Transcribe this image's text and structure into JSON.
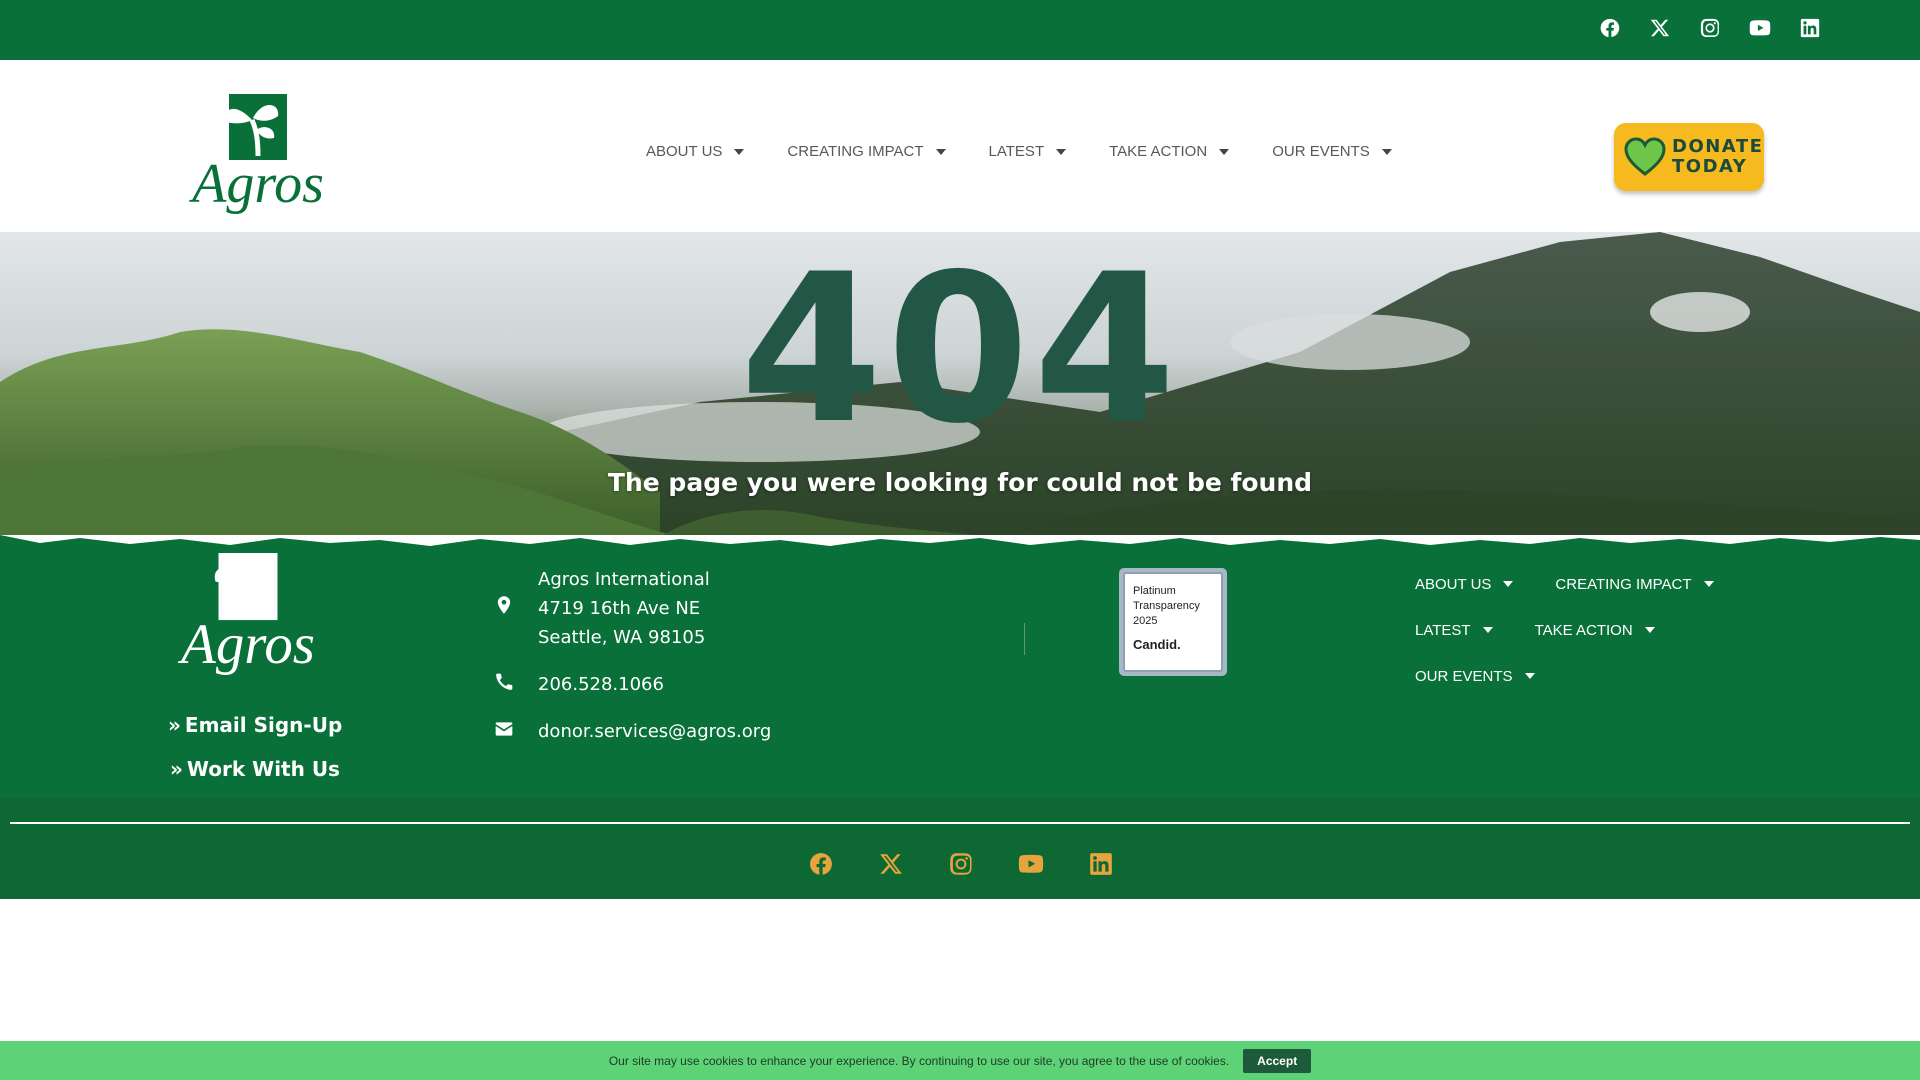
{
  "colors": {
    "brand_green": "#087038",
    "dark_green": "#225745",
    "donate_yellow": "#f6b91e",
    "social_orange": "#e7a33e",
    "cookie_green": "#5dd276"
  },
  "top_social": [
    {
      "icon": "facebook-icon"
    },
    {
      "icon": "x-twitter-icon"
    },
    {
      "icon": "instagram-icon"
    },
    {
      "icon": "youtube-icon"
    },
    {
      "icon": "linkedin-icon"
    }
  ],
  "header": {
    "logo_text": "Agros",
    "nav": [
      {
        "label": "ABOUT US"
      },
      {
        "label": "CREATING IMPACT"
      },
      {
        "label": "LATEST"
      },
      {
        "label": "TAKE ACTION"
      },
      {
        "label": "OUR EVENTS"
      }
    ],
    "donate": {
      "line1": "DONATE",
      "line2": "TODAY"
    }
  },
  "hero": {
    "code": "404",
    "message": "The page you were looking for could not be found"
  },
  "footer": {
    "logo_text": "Agros",
    "links": [
      {
        "label": "Email Sign-Up"
      },
      {
        "label": "Work With Us"
      }
    ],
    "contact": {
      "org": "Agros International",
      "street": "4719 16th Ave NE",
      "city": "Seattle, WA 98105",
      "phone": "206.528.1066",
      "email": "donor.services@agros.org"
    },
    "badge": {
      "line1": "Platinum",
      "line2": "Transparency",
      "line3": "2025",
      "brand": "Candid."
    },
    "nav": [
      {
        "label": "ABOUT US"
      },
      {
        "label": "CREATING IMPACT"
      },
      {
        "label": "LATEST"
      },
      {
        "label": "TAKE ACTION"
      },
      {
        "label": "OUR EVENTS"
      }
    ]
  },
  "bottom_social": [
    {
      "icon": "facebook-icon"
    },
    {
      "icon": "x-twitter-icon"
    },
    {
      "icon": "instagram-icon"
    },
    {
      "icon": "youtube-icon"
    },
    {
      "icon": "linkedin-icon"
    }
  ],
  "cookie": {
    "text": "Our site may use cookies to enhance your experience. By continuing to use our site, you agree to the use of cookies.",
    "accept": "Accept"
  }
}
